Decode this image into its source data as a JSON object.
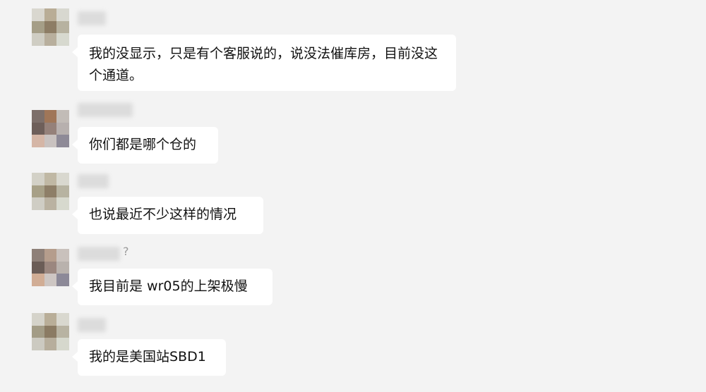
{
  "messages": [
    {
      "text": "我的没显示，只是有个客服说的，说没法催库房，目前没这个通道。"
    },
    {
      "text": "你们都是哪个仓的"
    },
    {
      "text": "也说最近不少这样的情况"
    },
    {
      "name_suffix": "?",
      "text": "我目前是 wr05的上架极慢"
    },
    {
      "text": "我的是美国站SBD1"
    }
  ],
  "colors": {
    "background": "#f3f3f3",
    "bubble": "#ffffff",
    "text": "#111111"
  }
}
